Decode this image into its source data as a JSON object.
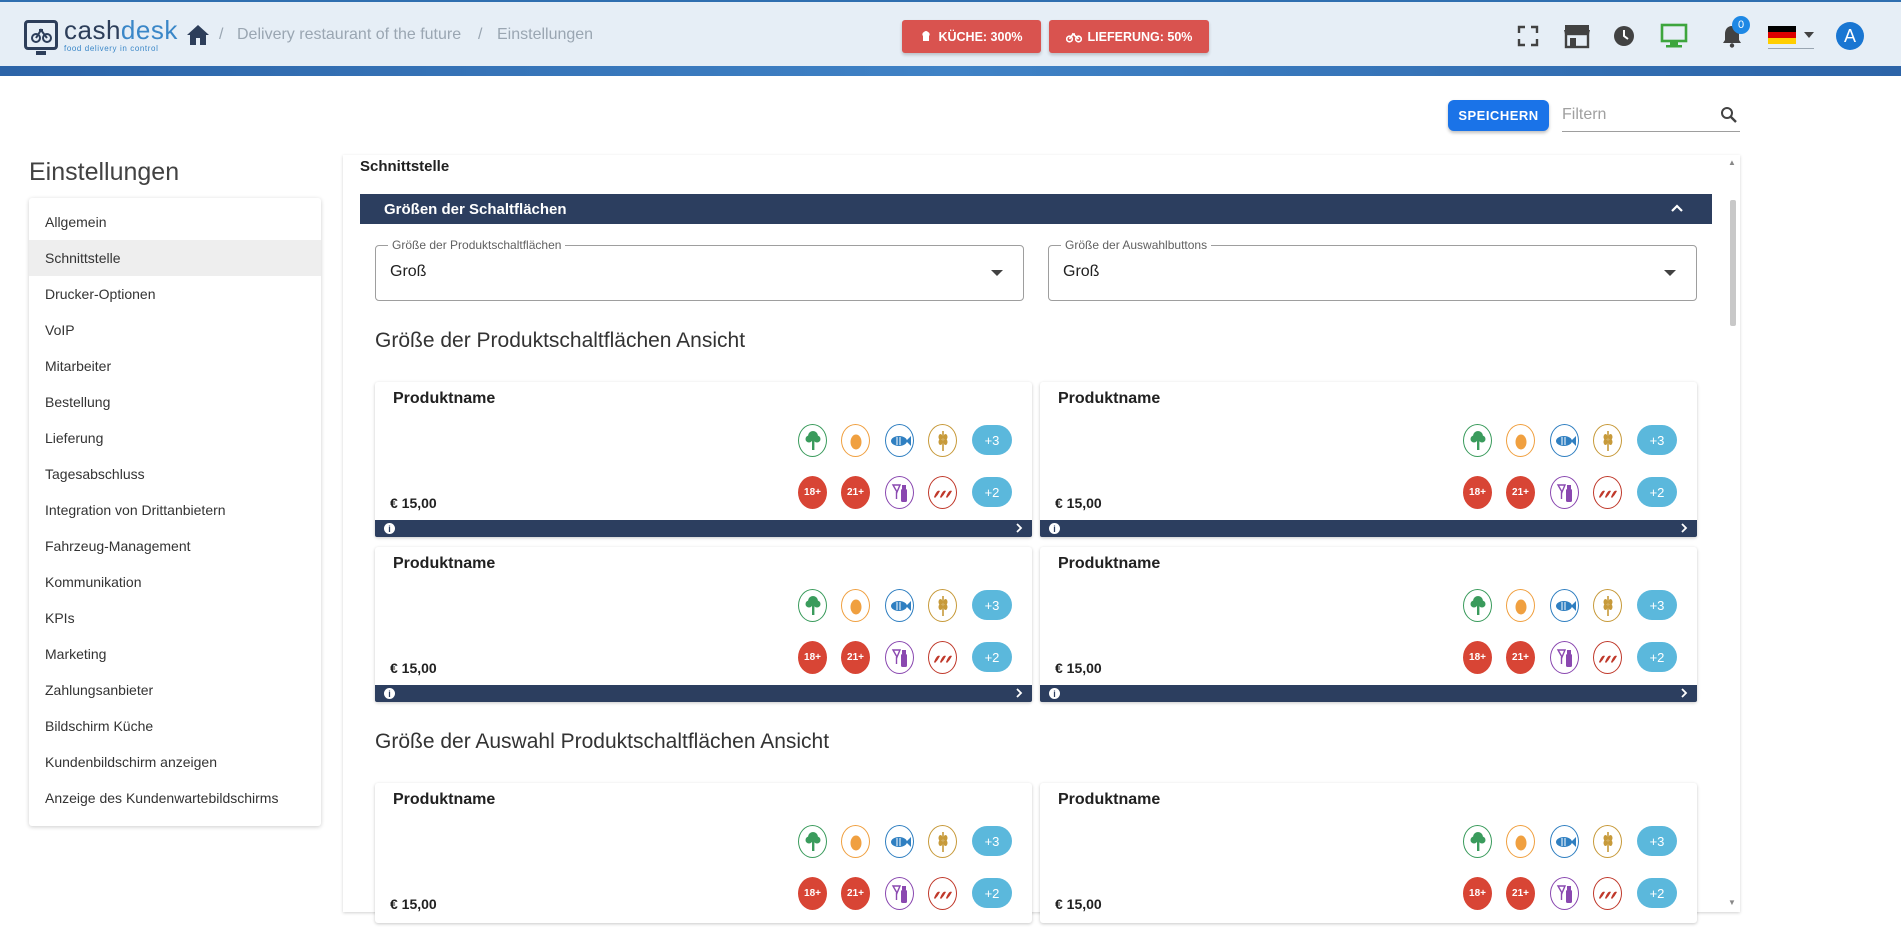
{
  "header": {
    "logo": {
      "name_part1": "cash",
      "name_part2": "desk",
      "tagline": "food delivery in control"
    },
    "breadcrumb": [
      "Delivery restaurant of the future",
      "Einstellungen"
    ],
    "breadcrumb_separator": "/",
    "kitchen_status": "KÜCHE: 300%",
    "delivery_status": "LIEFERUNG: 50%",
    "notification_count": "0",
    "avatar_initial": "A",
    "language": "de",
    "icons": [
      "home-icon",
      "fullscreen-icon",
      "store-icon",
      "clock-icon",
      "monitor-icon",
      "bell-icon",
      "flag-de-icon"
    ]
  },
  "toolbar": {
    "save_label": "SPEICHERN",
    "filter_placeholder": "Filtern"
  },
  "sidebar": {
    "title": "Einstellungen",
    "items": [
      {
        "label": "Allgemein",
        "active": false
      },
      {
        "label": "Schnittstelle",
        "active": true
      },
      {
        "label": "Drucker-Optionen",
        "active": false
      },
      {
        "label": "VoIP",
        "active": false
      },
      {
        "label": "Mitarbeiter",
        "active": false
      },
      {
        "label": "Bestellung",
        "active": false
      },
      {
        "label": "Lieferung",
        "active": false
      },
      {
        "label": "Tagesabschluss",
        "active": false
      },
      {
        "label": "Integration von Drittanbietern",
        "active": false
      },
      {
        "label": "Fahrzeug-Management",
        "active": false
      },
      {
        "label": "Kommunikation",
        "active": false
      },
      {
        "label": "KPIs",
        "active": false
      },
      {
        "label": "Marketing",
        "active": false
      },
      {
        "label": "Zahlungsanbieter",
        "active": false
      },
      {
        "label": "Bildschirm Küche",
        "active": false
      },
      {
        "label": "Kundenbildschirm anzeigen",
        "active": false
      },
      {
        "label": "Anzeige des Kundenwartebildschirms",
        "active": false
      }
    ]
  },
  "main": {
    "section_title": "Schnittstelle",
    "panel_title": "Größen der Schaltflächen",
    "selects": [
      {
        "label": "Größe der Produktschaltflächen",
        "value": "Groß"
      },
      {
        "label": "Größe der Auswahlbuttons",
        "value": "Groß"
      }
    ],
    "preview_heading": "Größe der Produktschaltflächen Ansicht",
    "selection_heading": "Größe der Auswahl Produktschaltflächen Ansicht",
    "card": {
      "name": "Produktname",
      "price": "€ 15,00",
      "more_top": "+3",
      "more_bottom": "+2",
      "age_labels": [
        "18+",
        "21+"
      ]
    },
    "colors": {
      "header_navy": "#2c3e5f",
      "status_red": "#d9534f",
      "primary_blue": "#1a73e8",
      "more_chip": "#5bb8dc",
      "vegan_green": "#3a9b5c",
      "egg_orange": "#f0a040",
      "fish_blue": "#2f7fc1",
      "gluten_tan": "#c79a3a",
      "age_red": "#d84535",
      "alcohol_purple": "#8a48b0",
      "spicy_red": "#c0392b"
    }
  }
}
